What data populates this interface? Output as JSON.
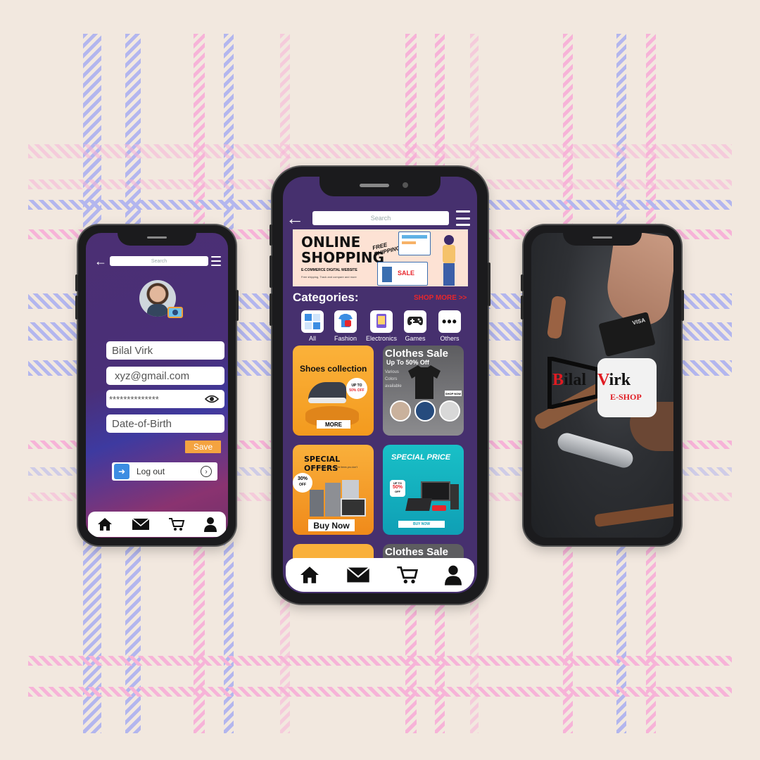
{
  "left_phone": {
    "search_placeholder": "Search",
    "profile": {
      "name_value": "Bilal Virk",
      "email_value": "xyz@gmail.com",
      "password_value": "**************",
      "dob_placeholder": "Date-of-Birth"
    },
    "save_label": "Save",
    "logout_label": "Log out"
  },
  "middle_phone": {
    "search_placeholder": "Search",
    "banner": {
      "title_line1": "ONLINE",
      "title_line2": "SHOPPING",
      "subtitle": "E-COMMERCE DIGITAL WEBSITE",
      "tagline": "Free shipping, Track and compare and more",
      "free_shipping": "FREE SHIPPING",
      "sale_tag": "SALE"
    },
    "categories_title": "Categories:",
    "shop_more_link": "SHOP MORE >>",
    "categories": [
      {
        "label": "All"
      },
      {
        "label": "Fashion"
      },
      {
        "label": "Electronics"
      },
      {
        "label": "Games"
      },
      {
        "label": "Others"
      }
    ],
    "cards": {
      "shoes": {
        "title": "Shoes collection",
        "badge_line1": "UP TO",
        "badge_line2": "50% OFF",
        "button": "MORE"
      },
      "clothes": {
        "title": "Clothes Sale",
        "subtitle": "Up To 50% Off",
        "note_line1": "Various",
        "note_line2": "Colors",
        "note_line3": "available",
        "button": "SHOP NOW"
      },
      "offers": {
        "title": "SPECIAL OFFERS",
        "desc": "Your successfully into the items you don't take",
        "badge_line1": "30%",
        "badge_line2": "OFF",
        "button": "Buy Now"
      },
      "price": {
        "title": "SPECIAL PRICE",
        "badge_line1": "UP TO",
        "badge_line2": "50%",
        "badge_line3": "OFF",
        "button": "BUY NOW"
      },
      "clothes2": {
        "title": "Clothes Sale"
      }
    }
  },
  "right_phone": {
    "logo_part1": "Bilal",
    "logo_part2": "Virk",
    "logo_part3": "E-SHOP",
    "card_brand": "VISA"
  },
  "colors": {
    "screen_purple": "#46306e",
    "accent_orange": "#f4a340",
    "shop_more_red": "#e8262b",
    "brand_red": "#e01b22"
  }
}
